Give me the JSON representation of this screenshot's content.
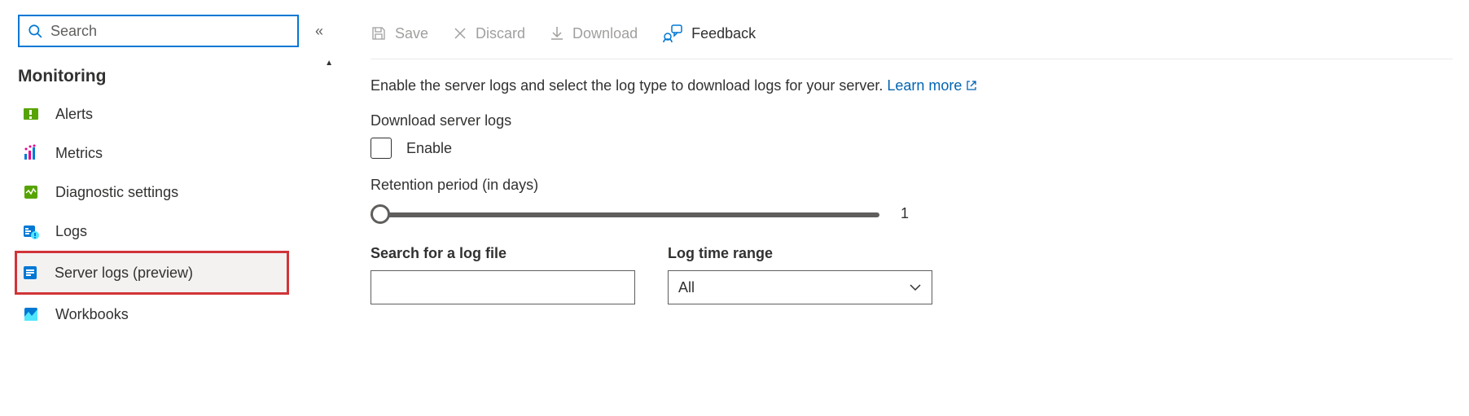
{
  "sidebar": {
    "search_placeholder": "Search",
    "section": "Monitoring",
    "items": [
      {
        "label": "Alerts"
      },
      {
        "label": "Metrics"
      },
      {
        "label": "Diagnostic settings"
      },
      {
        "label": "Logs"
      },
      {
        "label": "Server logs (preview)"
      },
      {
        "label": "Workbooks"
      }
    ]
  },
  "cmdbar": {
    "save": "Save",
    "discard": "Discard",
    "download": "Download",
    "feedback": "Feedback"
  },
  "description": "Enable the server logs and select the log type to download logs for your server.",
  "learn_more": "Learn more",
  "download_logs_label": "Download server logs",
  "enable_label": "Enable",
  "retention_label": "Retention period (in days)",
  "retention_value": "1",
  "search_log_label": "Search for a log file",
  "log_time_range_label": "Log time range",
  "log_time_range_value": "All"
}
